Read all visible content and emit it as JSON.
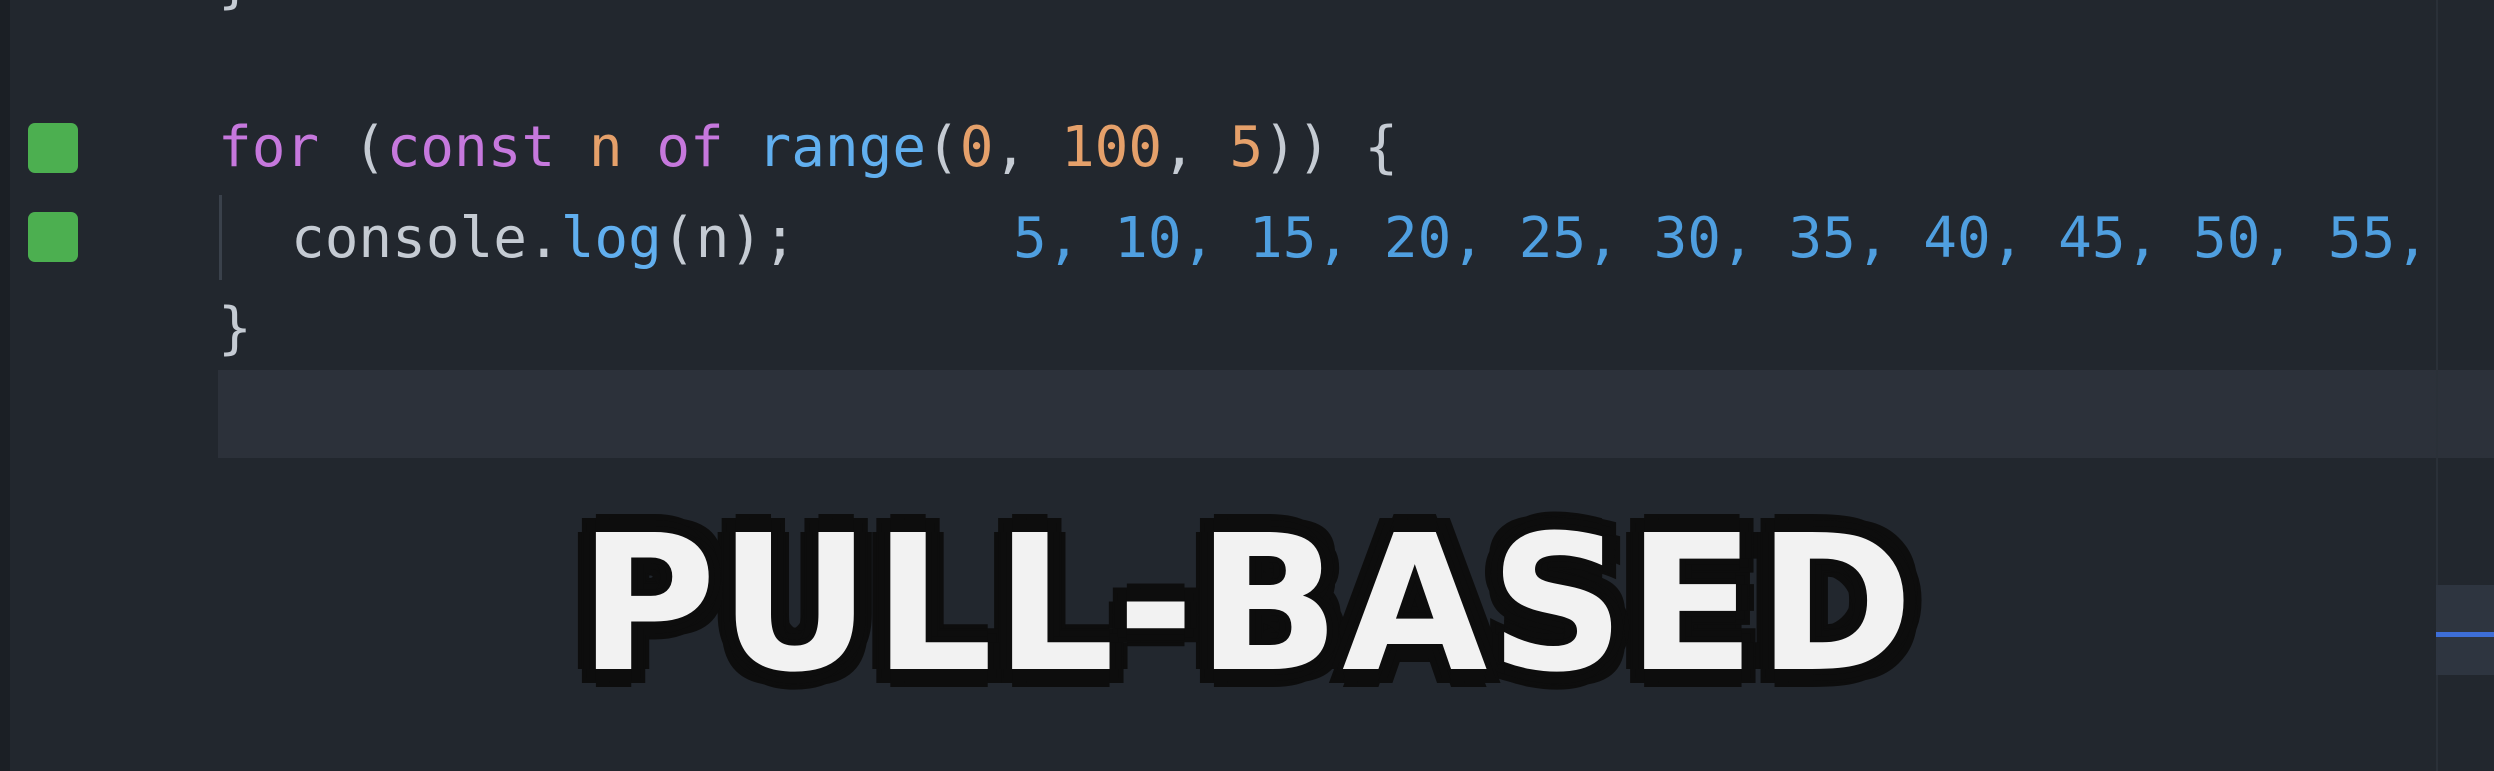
{
  "code": {
    "line_top_fragment": "}",
    "line_for": {
      "kw_for": "for",
      "paren_open": " (",
      "kw_const": "const",
      "space1": " ",
      "var_n": "n",
      "space2": " ",
      "kw_of": "of",
      "space3": " ",
      "fn_range": "range",
      "args_open": "(",
      "arg0": "0",
      "sep1": ", ",
      "arg1": "100",
      "sep2": ", ",
      "arg2": "5",
      "close": ")) {"
    },
    "line_console": {
      "obj": "console.",
      "method": "log",
      "args": "(n);"
    },
    "inline_output": "5, 10, 15, 20, 25, 30, 35, 40, 45, 50, 55,",
    "line_close": "}"
  },
  "overlay": {
    "caption": "PULL-BASED"
  },
  "colors": {
    "background": "#22272e",
    "keyword": "#c678dd",
    "number": "#e5a06a",
    "function": "#61afef",
    "output": "#4f9fe0",
    "breakpoint_marker": "#4caf50"
  }
}
